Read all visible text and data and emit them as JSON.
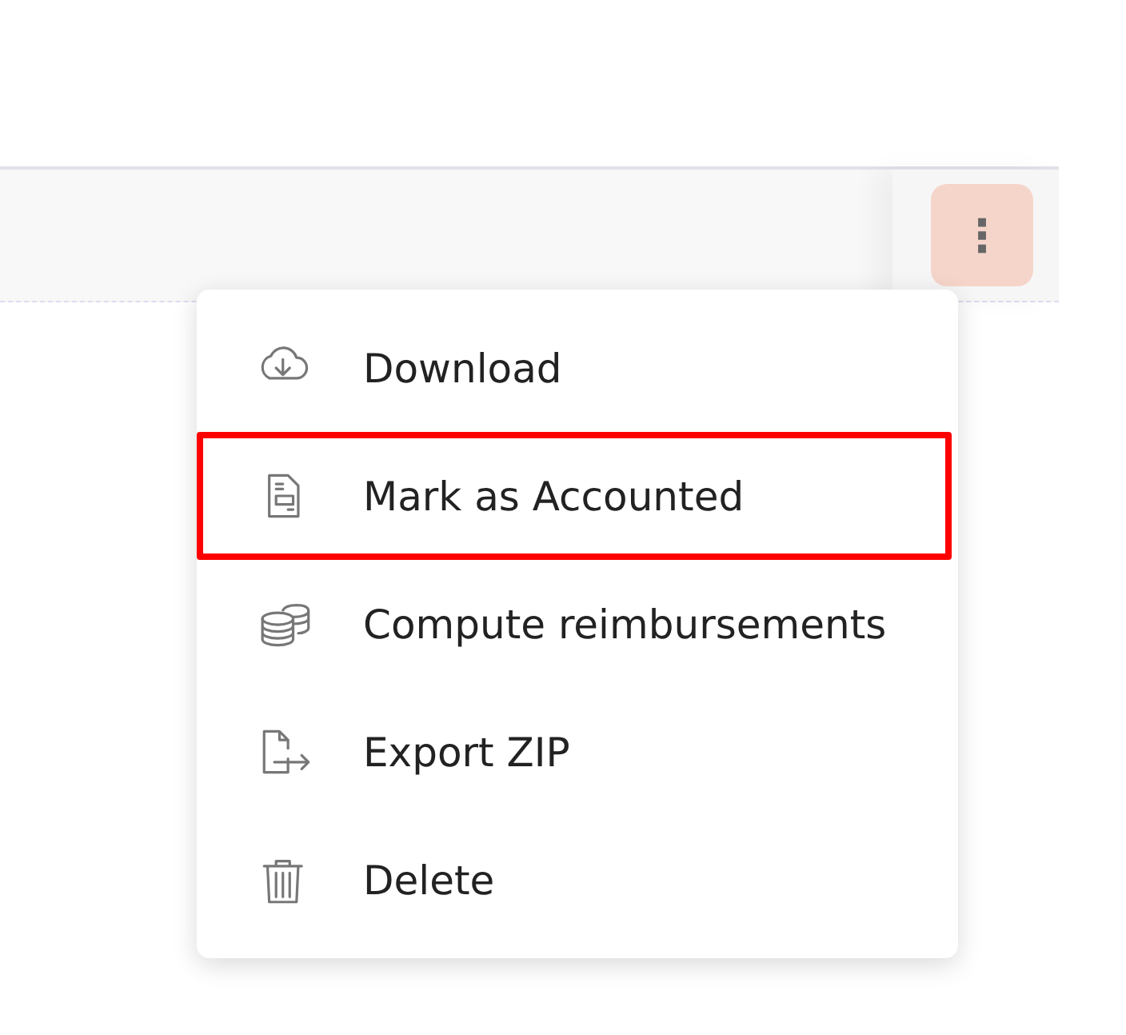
{
  "toolbar": {
    "menu_button": {
      "label": "⋮",
      "open": true
    }
  },
  "menu": {
    "items": [
      {
        "kind": "download",
        "label": "Download",
        "highlighted": false
      },
      {
        "kind": "document",
        "label": "Mark as Accounted",
        "highlighted": true
      },
      {
        "kind": "coins",
        "label": "Compute reimbursements",
        "highlighted": false
      },
      {
        "kind": "export",
        "label": "Export ZIP",
        "highlighted": false
      },
      {
        "kind": "trash",
        "label": "Delete",
        "highlighted": false
      }
    ]
  }
}
